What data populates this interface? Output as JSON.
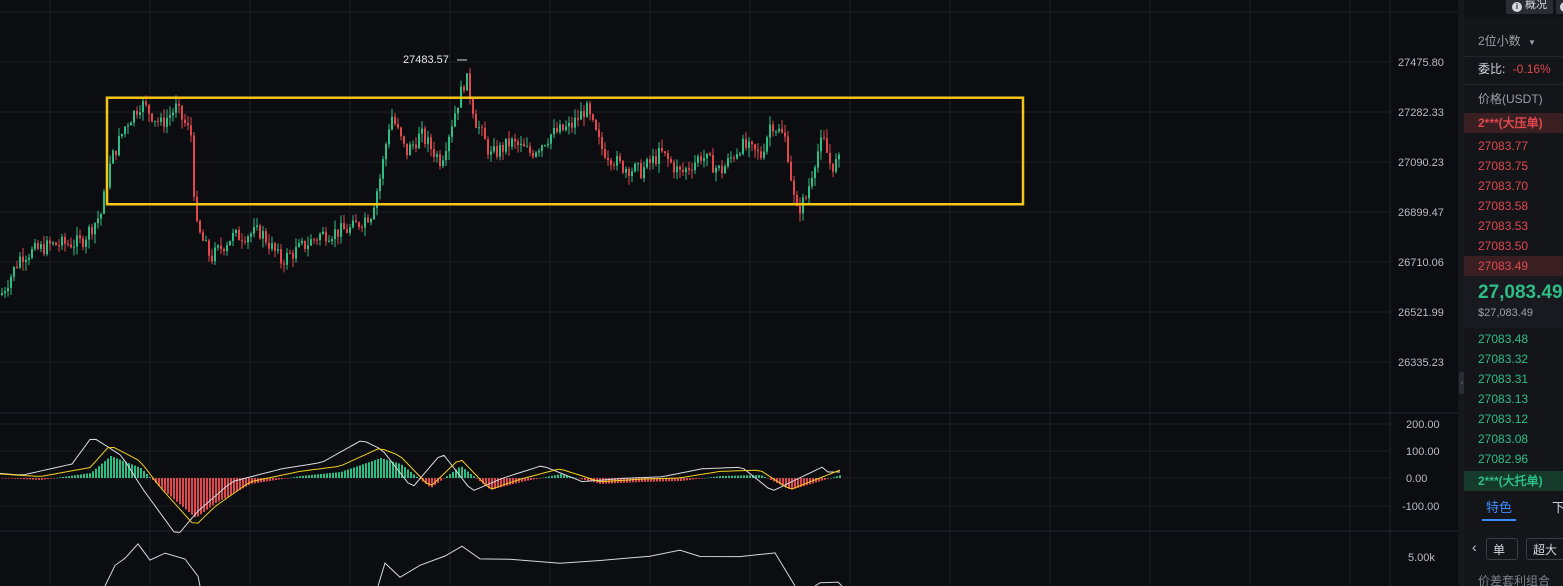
{
  "chart_data": {
    "type": "candlestick",
    "price_axis": {
      "ticks": [
        "27475.80",
        "27282.33",
        "27090.23",
        "26899.47",
        "26710.06",
        "26521.99",
        "26335.23"
      ]
    },
    "high_annotation": "27483.57",
    "range_box": {
      "top_price": 27340,
      "bottom_price": 26935,
      "color": "#f5c518"
    },
    "macd_axis": {
      "ticks": [
        "200.00",
        "100.00",
        "0.00",
        "-100.00"
      ]
    },
    "volume_axis": {
      "ticks": [
        "5.00k"
      ]
    },
    "colors": {
      "up": "#2ebd85",
      "down": "#e0484e",
      "grid": "#1c1e23",
      "signal": "#f0d020",
      "dif": "#d8dbe0"
    }
  },
  "orderbook": {
    "top_buttons": [
      "概况"
    ],
    "decimals_label": "2位小数",
    "commission_ratio_label": "委比:",
    "commission_ratio_value": "-0.16%",
    "price_header": "价格(USDT)",
    "big_ask_label": "2***(大压单)",
    "asks": [
      "27083.77",
      "27083.75",
      "27083.70",
      "27083.58",
      "27083.53",
      "27083.50",
      "27083.49"
    ],
    "mid_price": "27,083.49",
    "mid_price_usd": "$27,083.49",
    "bids": [
      "27083.48",
      "27083.32",
      "27083.31",
      "27083.13",
      "27083.12",
      "27083.08",
      "27082.96"
    ],
    "big_bid_label": "2***(大托单)",
    "tabs": [
      "特色",
      "下"
    ],
    "chips": [
      "单",
      "超大"
    ],
    "combo_label": "价差套利组合"
  }
}
